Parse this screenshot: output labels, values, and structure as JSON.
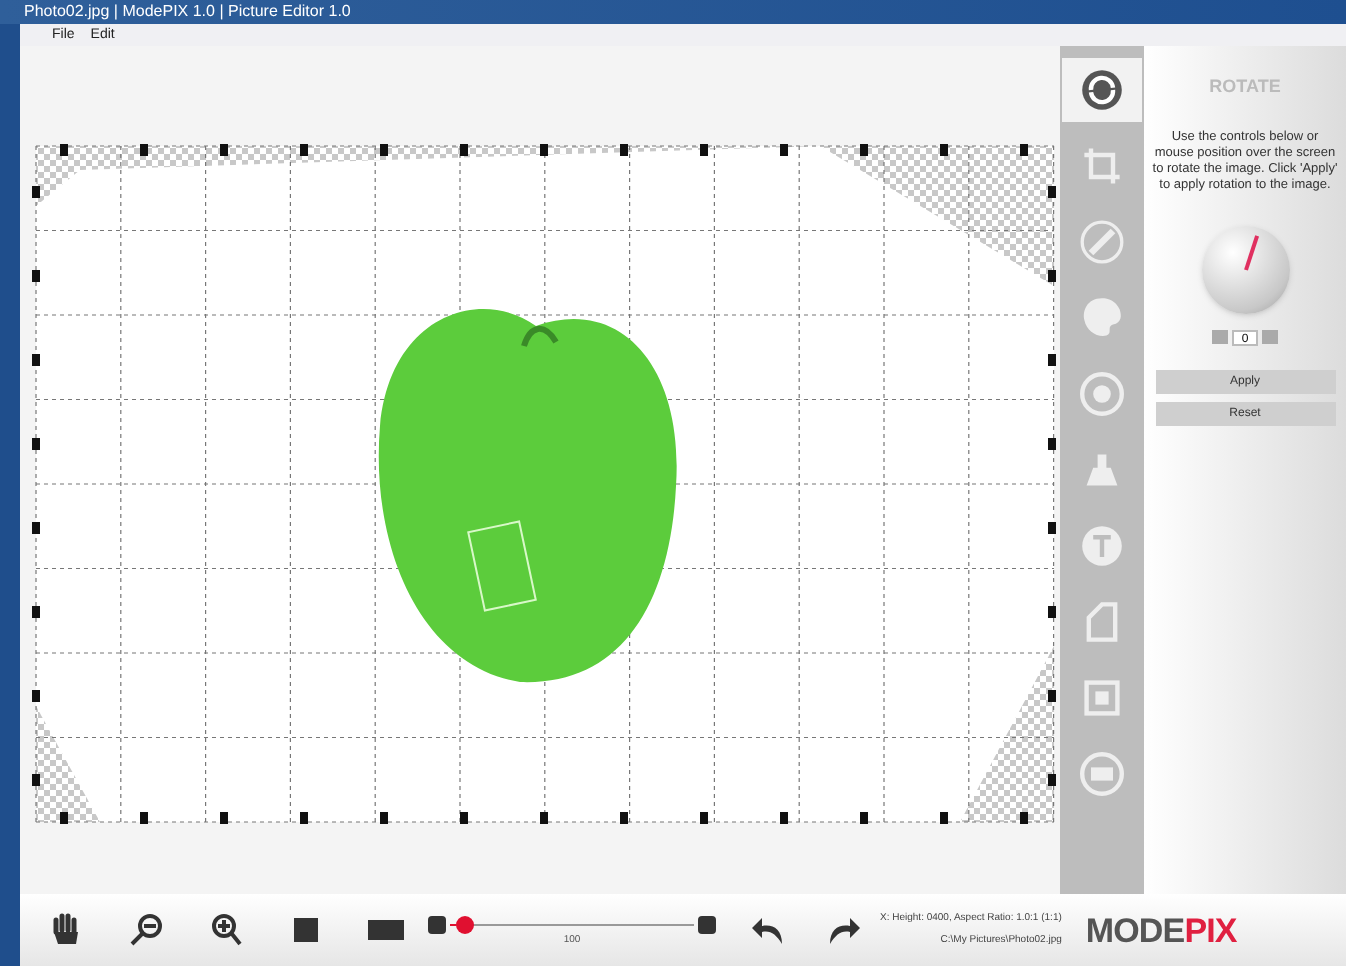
{
  "window": {
    "title": "Photo02.jpg | ModePIX 1.0 | Picture Editor 1.0"
  },
  "menu": [
    "File",
    "Edit"
  ],
  "tools": [
    {
      "kind": "rotate",
      "selected": true
    },
    {
      "kind": "crop",
      "selected": false
    },
    {
      "kind": "brush",
      "selected": false
    },
    {
      "kind": "palette",
      "selected": false
    },
    {
      "kind": "color",
      "selected": false
    },
    {
      "kind": "level",
      "selected": false
    },
    {
      "kind": "text",
      "selected": false
    },
    {
      "kind": "stamp",
      "selected": false
    },
    {
      "kind": "frame",
      "selected": false
    },
    {
      "kind": "film",
      "selected": false
    }
  ],
  "panel": {
    "title": "ROTATE",
    "instructions": "Use the controls below or mouse position over the screen to rotate the image. Click 'Apply' to apply rotation to the image.",
    "angle": "0",
    "buttons": [
      "Apply",
      "Reset"
    ]
  },
  "bottom_bar": {
    "zoom": {
      "level": 0.03,
      "reading": "100"
    },
    "info": "X: Height: 0400, Aspect Ratio: 1.0:1 (1:1)",
    "path": "C:\\My Pictures\\Photo02.jpg",
    "logo": [
      "MODE",
      "PIX"
    ]
  }
}
